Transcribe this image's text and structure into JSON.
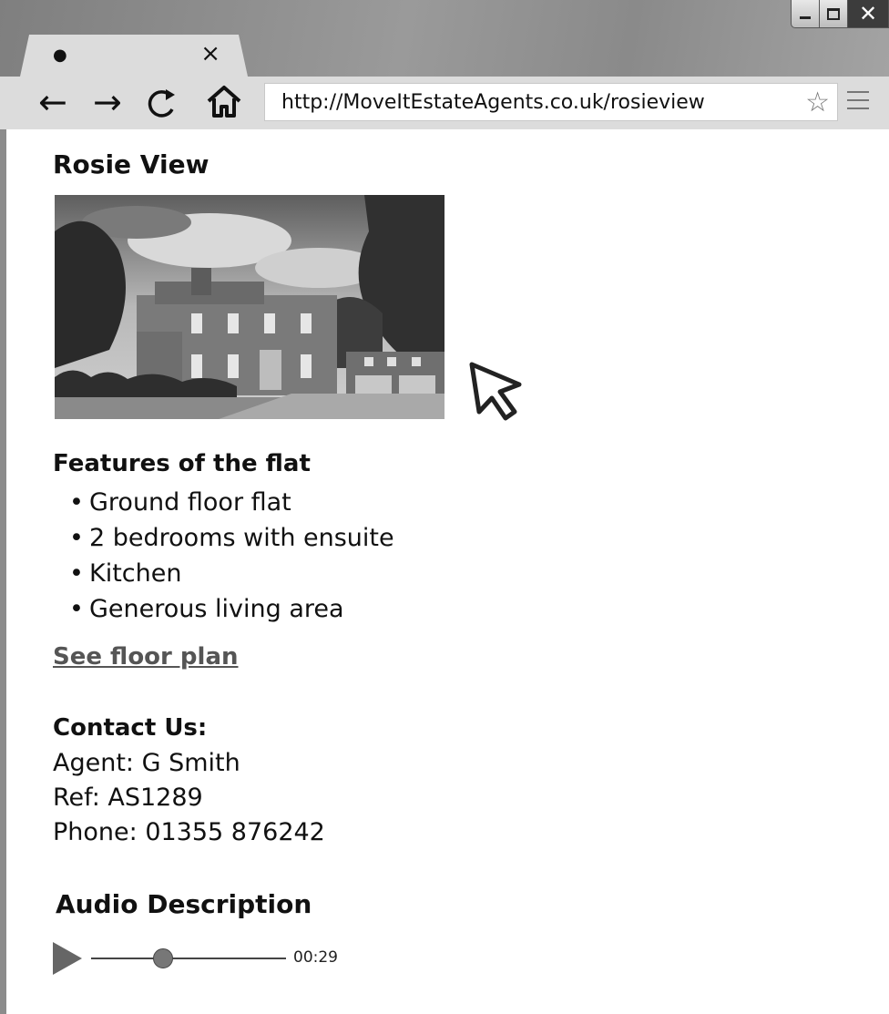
{
  "browser": {
    "tab_dot": "●",
    "tab_close": "×",
    "url": "http://MoveItEstateAgents.co.uk/rosieview",
    "window_close": "✕"
  },
  "page": {
    "title": "Rosie View",
    "features": {
      "heading": "Features of the flat",
      "items": [
        "Ground floor flat",
        "2 bedrooms with ensuite",
        "Kitchen",
        "Generous living area"
      ]
    },
    "floor_plan_link": "See floor plan",
    "contact": {
      "heading": "Contact Us:",
      "agent": "Agent: G Smith",
      "ref": "Ref: AS1289",
      "phone": "Phone: 01355 876242"
    },
    "audio": {
      "heading": "Audio Description",
      "time": "00:29",
      "progress": 0.37
    }
  },
  "icons": {
    "back": "arrow-left-icon",
    "forward": "arrow-right-icon",
    "reload": "reload-icon",
    "home": "home-icon",
    "bookmark": "star-icon",
    "menu": "hamburger-menu-icon",
    "cursor": "mouse-pointer-icon",
    "play": "play-icon"
  }
}
